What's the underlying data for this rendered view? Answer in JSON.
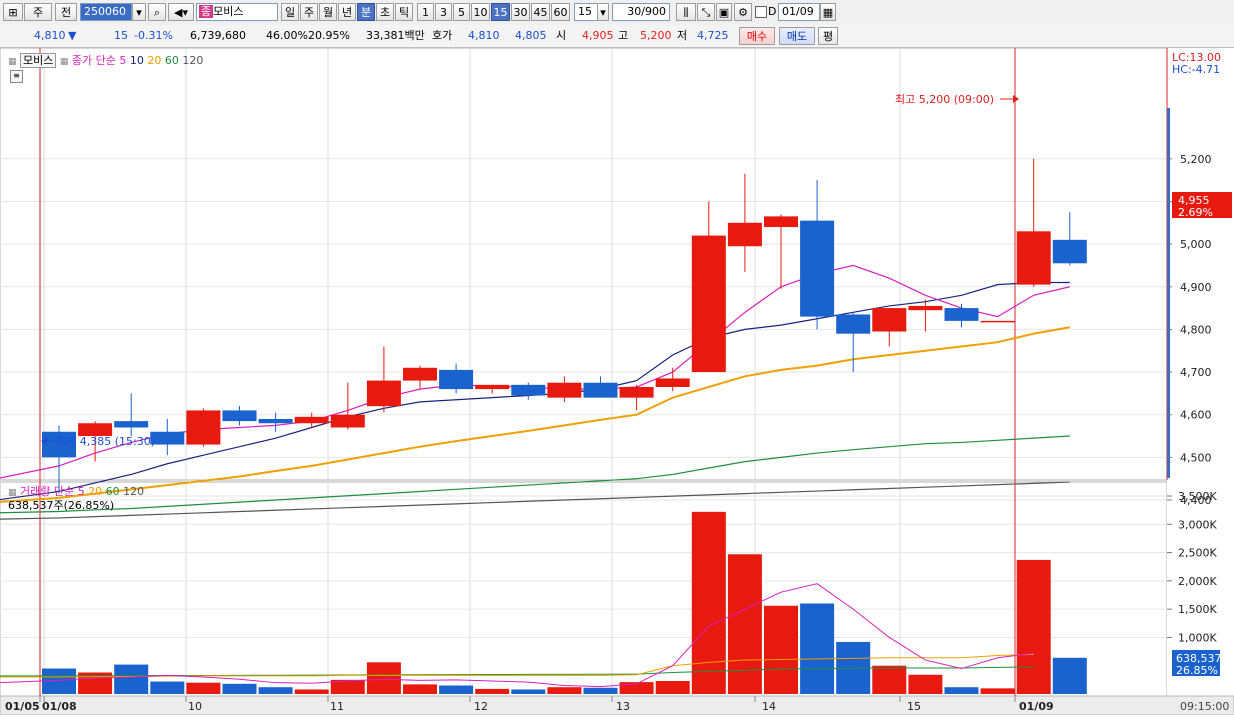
{
  "toolbar": {
    "type_label": "주",
    "prev_label": "전",
    "code_value": "250060",
    "stock_name": "모비스",
    "name_prefix": "종",
    "periods": [
      "일",
      "주",
      "월",
      "년",
      "분",
      "초",
      "틱"
    ],
    "active_period": "분",
    "intervals": [
      "1",
      "3",
      "5",
      "10",
      "15",
      "30",
      "45",
      "60"
    ],
    "active_interval": "15",
    "interval_select": "15",
    "count_value": "30/900",
    "checkbox_label": "D",
    "date_value": "01/09"
  },
  "infobar": {
    "price": "4,810",
    "change": "15",
    "change_pct": "-0.31%",
    "volume": "6,739,680",
    "rate1": "46.00%",
    "rate2": "20.95%",
    "amount": "33,381백만",
    "quote_label": "호가",
    "ask": "4,810",
    "bid": "4,805",
    "open_label": "시",
    "open": "4,905",
    "high_label": "고",
    "high": "5,200",
    "low_label": "저",
    "low": "4,725",
    "buy_label": "매수",
    "sell_label": "매도",
    "eval_label": "평"
  },
  "price_legend": {
    "name": "모비스",
    "type_label": "종가",
    "method": "단순",
    "ma_periods": [
      "5",
      "10",
      "20",
      "60",
      "120"
    ]
  },
  "price_axis": {
    "lc_label": "LC:13.00",
    "hc_label": "HC:-4.71",
    "ticks": [
      "5,200",
      "5,100",
      "5,000",
      "4,900",
      "4,800",
      "4,700",
      "4,600",
      "4,500",
      "4,400"
    ],
    "current_value": "4,955",
    "current_pct": "2.69%"
  },
  "annotations": {
    "high_text": "최고 5,200 (09:00)",
    "low_text": "최저 4,385 (15:30)"
  },
  "volume_legend": {
    "label": "거래량",
    "method": "단순",
    "ma_periods": [
      "5",
      "20",
      "60",
      "120"
    ],
    "current_text": "638,537주(26.85%)"
  },
  "volume_axis": {
    "ticks": [
      "3,500K",
      "3,000K",
      "2,500K",
      "2,000K",
      "1,500K",
      "1,000K"
    ],
    "current_value": "638,537",
    "current_pct": "26.85%"
  },
  "time_axis": {
    "labels": [
      "01/05",
      "01/08",
      "10",
      "11",
      "12",
      "13",
      "14",
      "15",
      "01/09"
    ],
    "time_label": "09:15:00"
  },
  "colors": {
    "up": "#e8190e",
    "down": "#1a62cd",
    "ma5": "#d81fbf",
    "ma10": "#1a237e",
    "ma20": "#f0a000",
    "ma60": "#1e8f3c",
    "ma120": "#555555"
  },
  "chart_data": {
    "type": "candlestick",
    "ylim": [
      4300,
      5260
    ],
    "candles": [
      {
        "o": 4560,
        "h": 4575,
        "l": 4415,
        "c": 4500
      },
      {
        "o": 4550,
        "h": 4585,
        "l": 4490,
        "c": 4580
      },
      {
        "o": 4585,
        "h": 4650,
        "l": 4550,
        "c": 4570
      },
      {
        "o": 4560,
        "h": 4590,
        "l": 4505,
        "c": 4530
      },
      {
        "o": 4530,
        "h": 4615,
        "l": 4525,
        "c": 4610
      },
      {
        "o": 4610,
        "h": 4620,
        "l": 4575,
        "c": 4585
      },
      {
        "o": 4590,
        "h": 4605,
        "l": 4560,
        "c": 4580
      },
      {
        "o": 4580,
        "h": 4605,
        "l": 4570,
        "c": 4595
      },
      {
        "o": 4570,
        "h": 4675,
        "l": 4565,
        "c": 4600
      },
      {
        "o": 4620,
        "h": 4760,
        "l": 4605,
        "c": 4680
      },
      {
        "o": 4680,
        "h": 4715,
        "l": 4660,
        "c": 4710
      },
      {
        "o": 4705,
        "h": 4720,
        "l": 4650,
        "c": 4660
      },
      {
        "o": 4660,
        "h": 4670,
        "l": 4650,
        "c": 4670
      },
      {
        "o": 4670,
        "h": 4675,
        "l": 4635,
        "c": 4645
      },
      {
        "o": 4640,
        "h": 4690,
        "l": 4630,
        "c": 4675
      },
      {
        "o": 4675,
        "h": 4690,
        "l": 4640,
        "c": 4640
      },
      {
        "o": 4640,
        "h": 4670,
        "l": 4610,
        "c": 4665
      },
      {
        "o": 4665,
        "h": 4710,
        "l": 4655,
        "c": 4685
      },
      {
        "o": 4700,
        "h": 5100,
        "l": 4700,
        "c": 5020
      },
      {
        "o": 4995,
        "h": 5165,
        "l": 4935,
        "c": 5050
      },
      {
        "o": 5040,
        "h": 5070,
        "l": 4895,
        "c": 5065
      },
      {
        "o": 5055,
        "h": 5150,
        "l": 4800,
        "c": 4830
      },
      {
        "o": 4835,
        "h": 4840,
        "l": 4700,
        "c": 4790
      },
      {
        "o": 4795,
        "h": 4850,
        "l": 4760,
        "c": 4850
      },
      {
        "o": 4845,
        "h": 4870,
        "l": 4795,
        "c": 4855
      },
      {
        "o": 4850,
        "h": 4860,
        "l": 4805,
        "c": 4820
      },
      {
        "o": 4820,
        "h": 4820,
        "l": 4820,
        "c": 4820
      },
      {
        "o": 4905,
        "h": 5200,
        "l": 4900,
        "c": 5030
      },
      {
        "o": 5010,
        "h": 5075,
        "l": 4950,
        "c": 4955
      }
    ],
    "ma5": [
      4450,
      4480,
      4510,
      4535,
      4555,
      4565,
      4570,
      4575,
      4585,
      4610,
      4640,
      4660,
      4670,
      4667,
      4665,
      4660,
      4660,
      4665,
      4700,
      4770,
      4840,
      4900,
      4930,
      4950,
      4920,
      4880,
      4850,
      4830,
      4880,
      4900
    ],
    "ma10": [
      4400,
      4420,
      4440,
      4460,
      4485,
      4505,
      4525,
      4545,
      4570,
      4595,
      4615,
      4630,
      4635,
      4640,
      4645,
      4650,
      4660,
      4680,
      4740,
      4780,
      4800,
      4810,
      4825,
      4840,
      4855,
      4865,
      4880,
      4905,
      4910
    ],
    "ma20": [
      4395,
      4405,
      4415,
      4425,
      4435,
      4445,
      4455,
      4468,
      4480,
      4495,
      4510,
      4525,
      4538,
      4550,
      4562,
      4575,
      4588,
      4600,
      4640,
      4665,
      4690,
      4705,
      4715,
      4730,
      4740,
      4750,
      4760,
      4770,
      4790,
      4805
    ],
    "ma60": [
      4370,
      4373,
      4377,
      4380,
      4385,
      4390,
      4395,
      4400,
      4405,
      4410,
      4415,
      4420,
      4425,
      4430,
      4435,
      4440,
      4445,
      4450,
      4460,
      4475,
      4490,
      4500,
      4510,
      4518,
      4525,
      4532,
      4535,
      4540,
      4545,
      4550
    ],
    "ma120": [
      4355,
      4358,
      4361,
      4364,
      4367,
      4370,
      4373,
      4376,
      4379,
      4382,
      4385,
      4388,
      4391,
      4394,
      4397,
      4400,
      4403,
      4406,
      4409,
      4412,
      4415,
      4418,
      4421,
      4424,
      4427,
      4430,
      4433,
      4436,
      4439,
      4442
    ],
    "volume": [
      450,
      380,
      520,
      220,
      200,
      180,
      120,
      80,
      250,
      560,
      170,
      150,
      90,
      80,
      120,
      110,
      210,
      230,
      3220,
      2470,
      1560,
      1600,
      920,
      500,
      340,
      120,
      100,
      2370,
      640
    ],
    "vol_ma5": [
      200,
      240,
      280,
      300,
      330,
      300,
      260,
      200,
      190,
      230,
      260,
      240,
      250,
      230,
      210,
      150,
      130,
      180,
      500,
      1200,
      1500,
      1800,
      1950,
      1500,
      1000,
      600,
      450,
      640,
      720
    ],
    "vol_ma20": [
      300,
      300,
      305,
      310,
      315,
      320,
      320,
      320,
      320,
      330,
      330,
      330,
      330,
      330,
      330,
      330,
      330,
      340,
      500,
      560,
      600,
      610,
      620,
      630,
      640,
      640,
      640,
      680,
      700
    ],
    "vol_ma60": [
      320,
      320,
      322,
      324,
      326,
      328,
      330,
      332,
      334,
      336,
      338,
      340,
      342,
      344,
      346,
      348,
      350,
      352,
      380,
      400,
      420,
      440,
      450,
      455,
      460,
      460,
      460,
      470,
      480
    ],
    "vol_ylim": [
      0,
      3700
    ]
  }
}
